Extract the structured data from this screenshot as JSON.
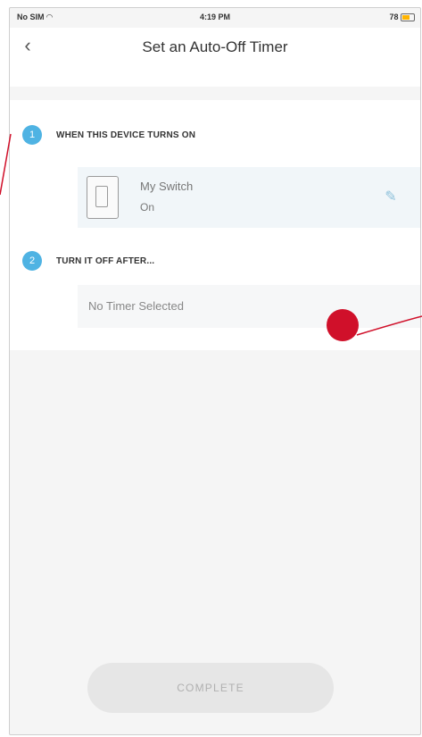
{
  "status_bar": {
    "carrier": "No SIM",
    "time": "4:19 PM",
    "battery": "78"
  },
  "header": {
    "back_glyph": "‹",
    "title": "Set an Auto-Off Timer"
  },
  "sections": [
    {
      "step": "1",
      "label": "WHEN THIS DEVICE TURNS ON",
      "device": {
        "name": "My Switch",
        "state": "On",
        "edit_glyph": "✎"
      }
    },
    {
      "step": "2",
      "label": "TURN IT OFF AFTER...",
      "value": "No Timer Selected"
    }
  ],
  "footer": {
    "complete_label": "COMPLETE"
  },
  "colors": {
    "accent": "#4fb3e3",
    "annotation": "#d0102a"
  },
  "icons": [
    "back-icon",
    "wifi-icon",
    "battery-icon",
    "switch-device-icon",
    "edit-icon"
  ]
}
